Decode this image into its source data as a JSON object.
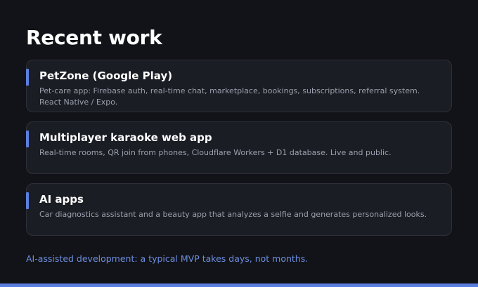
{
  "section": {
    "title": "Recent work"
  },
  "projects": [
    {
      "title": "PetZone (Google Play)",
      "description": "Pet-care app: Firebase auth, real-time chat, marketplace, bookings, subscriptions, referral system. React Native / Expo."
    },
    {
      "title": "Multiplayer karaoke web app",
      "description": "Real-time rooms, QR join from phones, Cloudflare Workers + D1 database. Live and public."
    },
    {
      "title": "AI apps",
      "description": "Car diagnostics assistant and a beauty app that analyzes a selfie and generates personalized looks."
    }
  ],
  "footer": {
    "note": "AI-assisted development: a typical MVP takes days, not months."
  },
  "colors": {
    "background": "#121318",
    "card_background": "#1b1d24",
    "accent": "#5b7fe0",
    "footer_text": "#6d8fe0"
  }
}
